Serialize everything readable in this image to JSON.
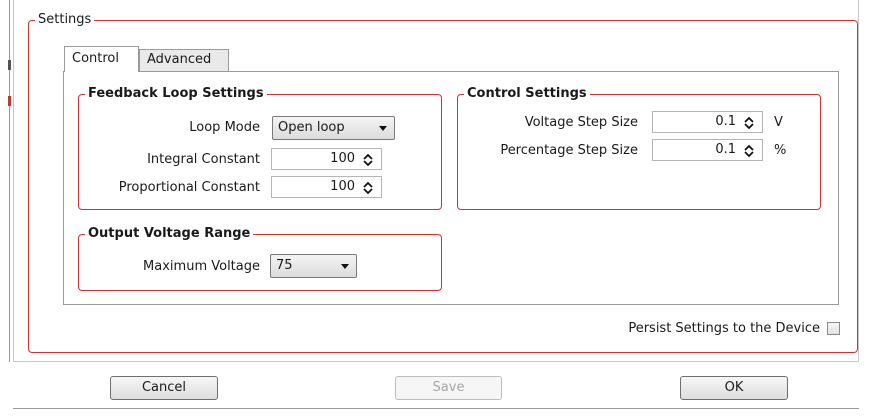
{
  "settings": {
    "group_title": "Settings",
    "tabs": [
      {
        "label": "Control",
        "active": true
      },
      {
        "label": "Advanced",
        "active": false
      }
    ],
    "feedback_loop": {
      "title": "Feedback Loop Settings",
      "loop_mode_label": "Loop Mode",
      "loop_mode_value": "Open loop",
      "integral_label": "Integral Constant",
      "integral_value": "100",
      "proportional_label": "Proportional Constant",
      "proportional_value": "100"
    },
    "output_voltage": {
      "title": "Output Voltage Range",
      "max_voltage_label": "Maximum Voltage",
      "max_voltage_value": "75"
    },
    "control_settings": {
      "title": "Control Settings",
      "voltage_step_label": "Voltage Step Size",
      "voltage_step_value": "0.1",
      "voltage_step_unit": "V",
      "percentage_step_label": "Percentage Step Size",
      "percentage_step_value": "0.1",
      "percentage_step_unit": "%"
    },
    "persist_label": "Persist Settings to the Device",
    "persist_checked": false
  },
  "buttons": {
    "cancel": "Cancel",
    "save": "Save",
    "ok": "OK"
  },
  "colors": {
    "group_border": "#cc3333",
    "tab_inactive_bg": "#e9e9e9",
    "disabled_text": "#a5a5a5"
  }
}
